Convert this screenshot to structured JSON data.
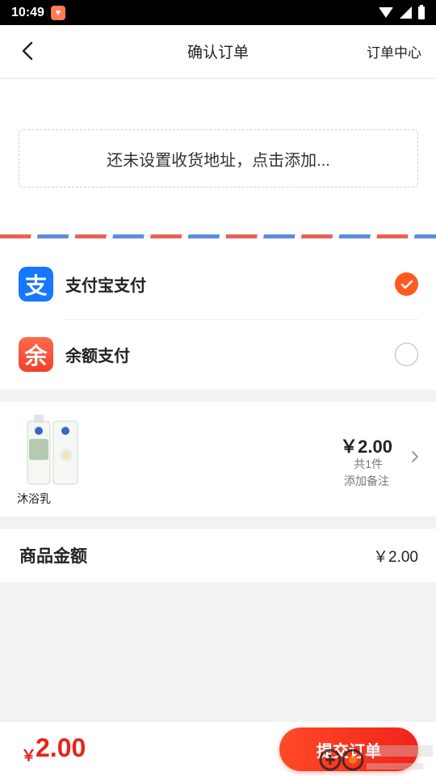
{
  "status_bar": {
    "time": "10:49"
  },
  "nav": {
    "title": "确认订单",
    "order_center": "订单中心"
  },
  "address": {
    "placeholder": "还未设置收货地址，点击添加..."
  },
  "payment": {
    "options": [
      {
        "label": "支付宝支付",
        "icon": "alipay-icon",
        "glyph": "支",
        "selected": true
      },
      {
        "label": "余额支付",
        "icon": "balance-icon",
        "glyph": "余",
        "selected": false
      }
    ]
  },
  "product": {
    "name": "沐浴乳",
    "price": "￥2.00",
    "count": "共1件",
    "remark": "添加备注"
  },
  "summary": {
    "label": "商品金额",
    "value": "￥2.00"
  },
  "bottom": {
    "currency": "￥",
    "amount": "2.00",
    "submit_label": "提交订单"
  },
  "colors": {
    "accent": "#ff5a1f",
    "price_red": "#e8221c",
    "alipay_blue": "#1677ff"
  }
}
